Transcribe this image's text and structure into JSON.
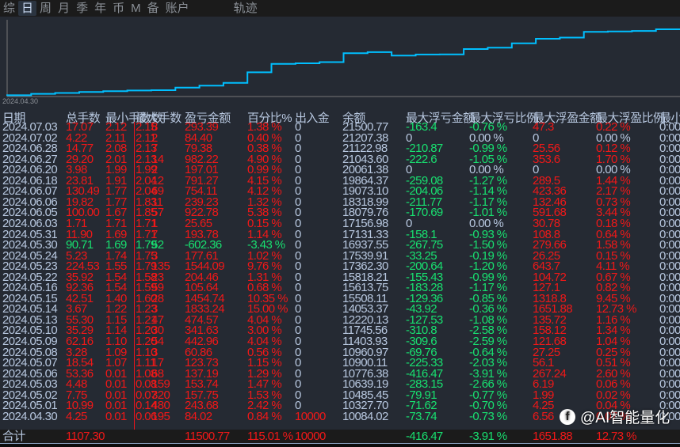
{
  "tabs": [
    "综",
    "日",
    "周",
    "月",
    "季",
    "年",
    "币",
    "M",
    "备",
    "账户",
    "轨迹"
  ],
  "active_tab": 1,
  "chart": {
    "start_label": "2024.04.30",
    "line_color": "#00bfff"
  },
  "headers": [
    "日期",
    "总手数",
    "最小手数",
    "最大手数",
    "数",
    "盈亏金额",
    "百分比%",
    "出入金",
    "余额",
    "最大浮亏金额",
    "最大浮亏比例",
    "最大浮盈金额",
    "最大浮盈比例",
    "最小"
  ],
  "rows": [
    [
      "2024.07.03",
      "17.07",
      "2.12",
      "2.15",
      "8",
      "293.39",
      "1.38 %",
      "0",
      "21500.77",
      "-163.4",
      "-0.76 %",
      "47.3",
      "0.22 %",
      "0:00"
    ],
    [
      "2024.07.02",
      "4.22",
      "2.11",
      "2.11",
      "2",
      "84.40",
      "0.40 %",
      "0",
      "21207.38",
      "0",
      "0.00 %",
      "0",
      "0.00 %",
      "0:00"
    ],
    [
      "2024.06.28",
      "14.77",
      "2.08",
      "2.13",
      "7",
      "79.38",
      "0.38 %",
      "0",
      "21122.98",
      "-210.87",
      "-0.99 %",
      "25.56",
      "0.12 %",
      "0:00"
    ],
    [
      "2024.06.27",
      "29.20",
      "2.01",
      "2.13",
      "14",
      "982.22",
      "4.90 %",
      "0",
      "21043.60",
      "-222.6",
      "-1.05 %",
      "353.6",
      "1.70 %",
      "0:00"
    ],
    [
      "2024.06.20",
      "3.98",
      "1.99",
      "1.99",
      "2",
      "197.01",
      "0.99 %",
      "0",
      "20061.38",
      "0",
      "0.00 %",
      "0",
      "0.00 %",
      "0:00"
    ],
    [
      "2024.06.18",
      "23.81",
      "1.91",
      "2.04",
      "12",
      "791.27",
      "4.15 %",
      "0",
      "19864.37",
      "-259.08",
      "-1.27 %",
      "289.5",
      "1.44 %",
      "0:00"
    ],
    [
      "2024.06.07",
      "130.49",
      "1.77",
      "2.04",
      "69",
      "754.11",
      "4.12 %",
      "0",
      "19073.10",
      "-204.06",
      "-1.14 %",
      "423.36",
      "2.17 %",
      "0:00"
    ],
    [
      "2024.06.06",
      "19.82",
      "1.77",
      "1.83",
      "11",
      "239.23",
      "1.32 %",
      "0",
      "18318.99",
      "-211.77",
      "-1.17 %",
      "132.46",
      "0.73 %",
      "0:00"
    ],
    [
      "2024.06.05",
      "100.00",
      "1.67",
      "1.85",
      "57",
      "922.78",
      "5.38 %",
      "0",
      "18079.76",
      "-170.69",
      "-1.01 %",
      "591.68",
      "3.44 %",
      "0:00"
    ],
    [
      "2024.06.03",
      "1.71",
      "1.71",
      "1.71",
      "1",
      "25.65",
      "0.15 %",
      "0",
      "17156.98",
      "0",
      "0.00 %",
      "30.78",
      "0.18 %",
      "0:00"
    ],
    [
      "2024.05.31",
      "11.90",
      "1.69",
      "1.71",
      "7",
      "193.78",
      "1.14 %",
      "0",
      "17131.33",
      "-158.1",
      "-0.93 %",
      "108.8",
      "0.64 %",
      "0:00"
    ],
    [
      "2024.05.30",
      "90.71",
      "1.69",
      "1.79",
      "52",
      "-602.36",
      "-3.43 %",
      "0",
      "16937.55",
      "-267.75",
      "-1.50 %",
      "279.66",
      "1.58 %",
      "0:00"
    ],
    [
      "2024.05.24",
      "5.23",
      "1.74",
      "1.75",
      "3",
      "177.61",
      "1.02 %",
      "0",
      "17539.91",
      "-33.25",
      "-0.19 %",
      "26.25",
      "0.15 %",
      "0:00"
    ],
    [
      "2024.05.23",
      "224.53",
      "1.55",
      "1.79",
      "135",
      "1544.09",
      "9.76 %",
      "0",
      "17362.30",
      "-200.64",
      "-1.20 %",
      "643.7",
      "4.11 %",
      "0:00"
    ],
    [
      "2024.05.22",
      "35.92",
      "1.54",
      "1.58",
      "23",
      "204.46",
      "1.31 %",
      "0",
      "15818.21",
      "-155.43",
      "-0.99 %",
      "104.72",
      "0.67 %",
      "0:00"
    ],
    [
      "2024.05.16",
      "92.36",
      "1.54",
      "1.59",
      "59",
      "105.64",
      "0.68 %",
      "0",
      "15613.75",
      "-183.28",
      "-1.17 %",
      "127.1",
      "0.82 %",
      "0:00"
    ],
    [
      "2024.05.15",
      "42.51",
      "1.40",
      "1.60",
      "28",
      "1454.74",
      "10.35 %",
      "0",
      "15508.11",
      "-129.36",
      "-0.85 %",
      "1318.8",
      "9.45 %",
      "0:00"
    ],
    [
      "2024.05.14",
      "3.67",
      "1.22",
      "1.23",
      "3",
      "1833.24",
      "15.00 %",
      "0",
      "14053.37",
      "-43.92",
      "-0.36 %",
      "1651.88",
      "12.73 %",
      "0:00"
    ],
    [
      "2024.05.13",
      "55.30",
      "1.15",
      "1.21",
      "47",
      "474.57",
      "4.04 %",
      "0",
      "12220.13",
      "-127.53",
      "-1.08 %",
      "135.72",
      "1.16 %",
      "0:00"
    ],
    [
      "2024.05.10",
      "35.29",
      "1.14",
      "1.20",
      "30",
      "341.63",
      "3.00 %",
      "0",
      "11745.56",
      "-310.8",
      "-2.58 %",
      "158.12",
      "1.34 %",
      "0:00"
    ],
    [
      "2024.05.09",
      "62.16",
      "1.10",
      "1.20",
      "54",
      "442.96",
      "4.04 %",
      "0",
      "11403.93",
      "-309.6",
      "-2.59 %",
      "121.68",
      "1.04 %",
      "0:00"
    ],
    [
      "2024.05.08",
      "3.28",
      "1.09",
      "1.10",
      "3",
      "60.86",
      "0.56 %",
      "0",
      "10960.97",
      "-69.76",
      "-0.64 %",
      "27.25",
      "0.25 %",
      "0:00"
    ],
    [
      "2024.05.07",
      "18.54",
      "1.07",
      "1.11",
      "17",
      "123.73",
      "1.15 %",
      "0",
      "10900.11",
      "-225.33",
      "-2.03 %",
      "56.1",
      "0.51 %",
      "0:00"
    ],
    [
      "2024.05.06",
      "53.36",
      "0.01",
      "1.08",
      "68",
      "137.19",
      "1.29 %",
      "0",
      "10776.38",
      "-416.47",
      "-3.91 %",
      "267.24",
      "2.60 %",
      "0:00"
    ],
    [
      "2024.05.03",
      "4.48",
      "0.01",
      "0.08",
      "159",
      "153.74",
      "1.47 %",
      "0",
      "10639.19",
      "-283.15",
      "-2.66 %",
      "6.19",
      "0.06 %",
      "0:00"
    ],
    [
      "2024.05.02",
      "7.75",
      "0.01",
      "0.07",
      "320",
      "157.75",
      "1.53 %",
      "0",
      "10485.45",
      "-79.91",
      "-0.77 %",
      "1.99",
      "0.02 %",
      "0:00"
    ],
    [
      "2024.05.01",
      "10.99",
      "0.01",
      "0.14",
      "480",
      "243.68",
      "2.42 %",
      "0",
      "10327.70",
      "-71.62",
      "-0.70 %",
      "4.25",
      "0.04 %",
      "0:00"
    ],
    [
      "2024.04.30",
      "4.25",
      "0.01",
      "0.06",
      "195",
      "84.02",
      "0.84 %",
      "10000",
      "10084.02",
      "-73.74",
      "-0.73 %",
      "6.56",
      "0.07 %",
      "0:00"
    ]
  ],
  "footer": {
    "label": "合计",
    "total_lots": "1107.30",
    "pnl": "11500.77",
    "pct": "115.01 %",
    "inout": "10000",
    "max_loss": "-416.47",
    "max_loss_pct": "-3.91 %",
    "max_profit": "1651.88",
    "max_profit_pct": "12.73 %"
  },
  "watermark": "@AI智能量化",
  "colors": {
    "up": "#f01818",
    "down": "#18e070",
    "text": "#b8c8e0"
  }
}
